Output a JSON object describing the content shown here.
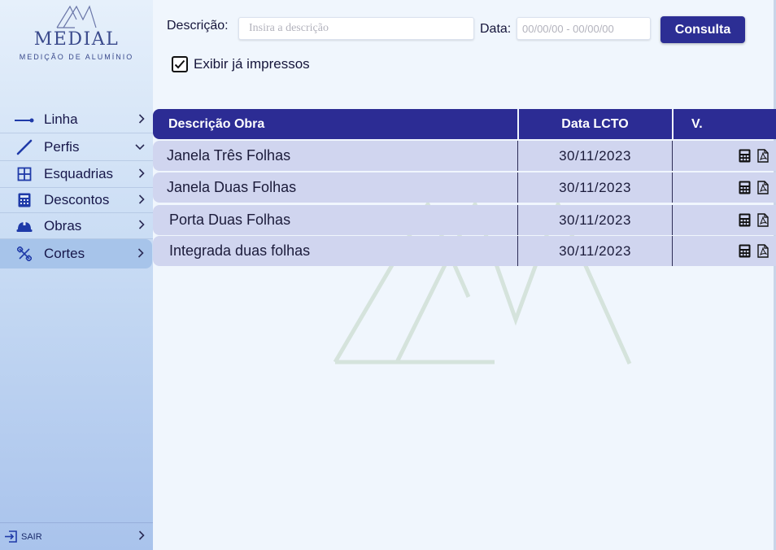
{
  "brand": {
    "name": "MEDIAL",
    "tagline": "MEDIÇÃO DE ALUMÍNIO"
  },
  "sidebar": {
    "items": [
      {
        "label": "Linha",
        "icon": "line-icon",
        "chevron": ">"
      },
      {
        "label": "Perfis",
        "icon": "slash-icon",
        "chevron": "v"
      },
      {
        "label": "Esquadrias",
        "icon": "window-grid-icon",
        "chevron": ">"
      },
      {
        "label": "Descontos",
        "icon": "calculator-icon",
        "chevron": ">"
      },
      {
        "label": "Obras",
        "icon": "hard-hat-icon",
        "chevron": ">"
      },
      {
        "label": "Cortes",
        "icon": "tools-icon",
        "chevron": ">",
        "active": true
      }
    ],
    "logout": {
      "label": "SAIR",
      "icon": "exit-icon",
      "chevron": ">"
    }
  },
  "filters": {
    "description_label": "Descrição:",
    "description_placeholder": "Insira a descrição",
    "date_label": "Data:",
    "date_placeholder": "00/00/00 - 00/00/00",
    "submit_label": "Consulta",
    "show_printed_label": "Exibir já impressos",
    "show_printed_checked": true
  },
  "table": {
    "headers": [
      "Descrição Obra",
      "Data LCTO",
      "V."
    ],
    "rows": [
      {
        "description": "Janela Três Folhas",
        "date": "30/11/2023"
      },
      {
        "description": "Janela Duas Folhas",
        "date": "30/11/2023"
      },
      {
        "description": "Porta Duas Folhas",
        "date": "30/11/2023"
      },
      {
        "description": "Integrada duas folhas",
        "date": "30/11/2023"
      }
    ],
    "row_actions": [
      "calculator-icon",
      "pdf-icon"
    ]
  },
  "colors": {
    "primary": "#2c2c94",
    "row_bg": "#d0d5ef",
    "sidebar_active": "#a7c4ea",
    "page_bg": "#f0f6fd"
  }
}
